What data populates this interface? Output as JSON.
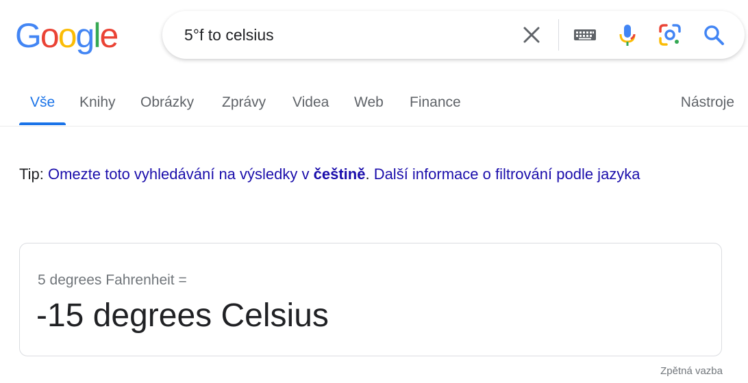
{
  "logo": {
    "letters": [
      "G",
      "o",
      "o",
      "g",
      "l",
      "e"
    ],
    "colors": [
      "#4285f4",
      "#ea4335",
      "#fbbc05",
      "#4285f4",
      "#34a853",
      "#ea4335"
    ]
  },
  "search": {
    "query": "5°f to celsius",
    "icons": [
      "close-icon",
      "keyboard-icon",
      "microphone-icon",
      "google-lens-icon",
      "search-icon"
    ]
  },
  "tabs": {
    "items": [
      "Vše",
      "Knihy",
      "Obrázky",
      "Zprávy",
      "Videa",
      "Web",
      "Finance"
    ],
    "active": "Vše",
    "tools": "Nástroje"
  },
  "tip": {
    "prefix": "Tip: ",
    "link1": "Omezte toto vyhledávání na výsledky v ",
    "lang": "češtině",
    "sep": ". ",
    "link2": "Další informace o filtrování podle jazyka"
  },
  "conversion": {
    "from": "5 degrees Fahrenheit =",
    "to": "-15 degrees Celsius"
  },
  "feedback": "Zpětná vazba"
}
